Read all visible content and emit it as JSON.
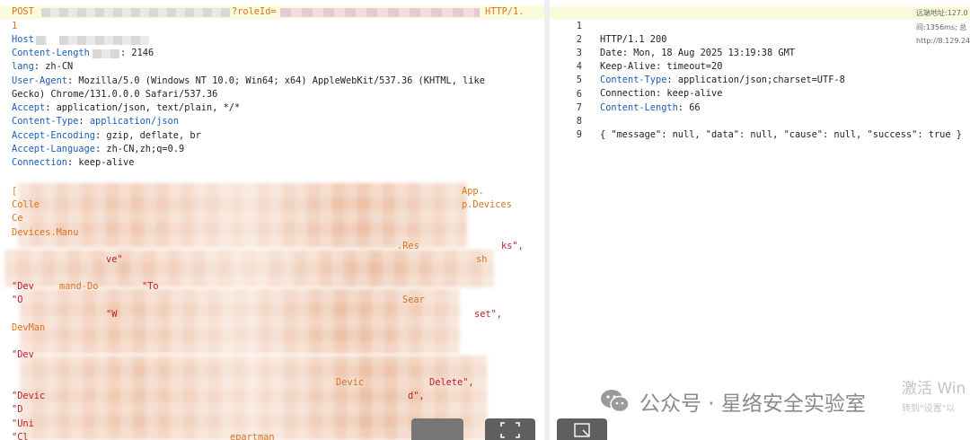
{
  "request": {
    "method": "POST",
    "query_param": "?roleId=",
    "protocol": "HTTP/1.",
    "protocol_wrap": "1",
    "headers": [
      {
        "name": "Host",
        "sep": ":",
        "value": ""
      },
      {
        "name": "Content-Length",
        "sep": ":",
        "value": "2146"
      },
      {
        "name": "lang",
        "sep": ":",
        "value": "zh-CN"
      },
      {
        "name": "User-Agent",
        "sep": ":",
        "value": "Mozilla/5.0 (Windows NT 10.0; Win64; x64) AppleWebKit/537.36 (KHTML, like"
      },
      {
        "name": "",
        "sep": "",
        "value": "Gecko) Chrome/131.0.0.0 Safari/537.36"
      },
      {
        "name": "Accept",
        "sep": ":",
        "value": "application/json, text/plain, */*"
      },
      {
        "name": "Content-Type",
        "sep": ":",
        "value": "application/json"
      },
      {
        "name": "Accept-Encoding",
        "sep": ":",
        "value": "gzip, deflate, br"
      },
      {
        "name": "Accept-Language",
        "sep": ":",
        "value": "zh-CN,zh;q=0.9"
      },
      {
        "name": "Connection",
        "sep": ":",
        "value": "keep-alive"
      }
    ],
    "body_fragments": [
      {
        "text": "[",
        "cls": "k-orange"
      },
      {
        "text": "App.",
        "cls": "k-orange"
      },
      {
        "text": "Colle",
        "cls": "k-orange"
      },
      {
        "text": "p.Devices",
        "cls": "k-orange"
      },
      {
        "text": "Ce",
        "cls": "k-orange"
      },
      {
        "text": "Devices.Manu",
        "cls": "k-orange"
      },
      {
        "text": ".Res",
        "cls": "k-orange"
      },
      {
        "text": "ks\",",
        "cls": "k-red"
      },
      {
        "text": "ve\"",
        "cls": "k-red"
      },
      {
        "text": "sh",
        "cls": "k-orange"
      },
      {
        "text": "\"Dev",
        "cls": "k-red"
      },
      {
        "text": "mand-Do",
        "cls": "k-orange"
      },
      {
        "text": "\"To",
        "cls": "k-red"
      },
      {
        "text": "\"O",
        "cls": "k-red"
      },
      {
        "text": "Sear",
        "cls": "k-orange"
      },
      {
        "text": "\"W",
        "cls": "k-red"
      },
      {
        "text": "set\",",
        "cls": "k-red"
      },
      {
        "text": "DevMan",
        "cls": "k-orange"
      },
      {
        "text": "\"Dev",
        "cls": "k-red"
      },
      {
        "text": "Devic",
        "cls": "k-orange"
      },
      {
        "text": "Delete\",",
        "cls": "k-red"
      },
      {
        "text": "\"Devic",
        "cls": "k-red"
      },
      {
        "text": "d\",",
        "cls": "k-red"
      },
      {
        "text": "\"D",
        "cls": "k-red"
      },
      {
        "text": "\"Uni",
        "cls": "k-red"
      },
      {
        "text": "\"Cl",
        "cls": "k-red"
      },
      {
        "text": "epartman",
        "cls": "k-orange"
      }
    ]
  },
  "response": {
    "lines": [
      {
        "num": "1",
        "name": "HTTP/1.1 200",
        "value": ""
      },
      {
        "num": "2",
        "name": "Date",
        "value": "Mon, 18 Aug 2025 13:19:38 GMT"
      },
      {
        "num": "3",
        "name": "Keep-Alive",
        "value": "timeout=20"
      },
      {
        "num": "4",
        "name": "Content-Type",
        "value": "application/json;charset=UTF-8"
      },
      {
        "num": "5",
        "name": "Connection",
        "value": "keep-alive"
      },
      {
        "num": "6",
        "name": "Content-Length",
        "value": "66"
      },
      {
        "num": "7",
        "name": "",
        "value": ""
      },
      {
        "num": "8",
        "name": "",
        "value": "{ \"message\": null, \"data\": null, \"cause\": null, \"success\": true }"
      },
      {
        "num": "9",
        "name": "",
        "value": ""
      }
    ],
    "side_notes": [
      "远端地址:127.0",
      "间:1356ms; 总",
      "http://8.129.24"
    ]
  },
  "watermark": {
    "text": "公众号 · 星络安全实验室",
    "activate_line1": "激活 Win",
    "activate_line2": "转到\"设置\"以"
  },
  "colors": {
    "orange": "#d9731f",
    "blue": "#1a5fb4",
    "red": "#c01c28",
    "highlight": "#fbfbdc"
  }
}
